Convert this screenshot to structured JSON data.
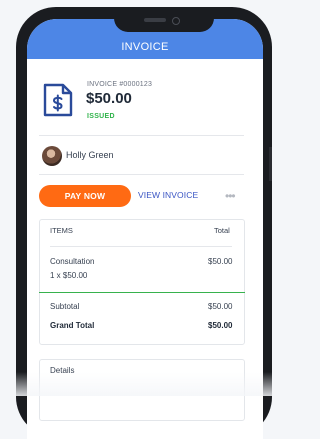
{
  "app_bar": {
    "title": "INVOICE"
  },
  "invoice": {
    "number": "INVOICE #0000123",
    "amount": "$50.00",
    "status": "ISSUED"
  },
  "customer": {
    "name": "Holly Green"
  },
  "actions": {
    "pay_now_label": "PAY NOW",
    "view_invoice_label": "VIEW INVOICE",
    "more_label": "•••"
  },
  "items_card": {
    "header_items": "ITEMS",
    "header_total": "Total",
    "line_items": [
      {
        "name": "Consultation",
        "detail": "1 x $50.00",
        "total": "$50.00"
      }
    ],
    "subtotal_label": "Subtotal",
    "subtotal_value": "$50.00",
    "grand_total_label": "Grand Total",
    "grand_total_value": "$50.00"
  },
  "details_card": {
    "title": "Details"
  },
  "colors": {
    "app_bar": "#4d86e6",
    "primary_button": "#ff6a13",
    "link": "#3a55c4",
    "status_issued": "#2fb34a",
    "divider_accent": "#37b24d"
  },
  "icons": [
    "invoice-dollar-icon",
    "more-dots-icon"
  ]
}
